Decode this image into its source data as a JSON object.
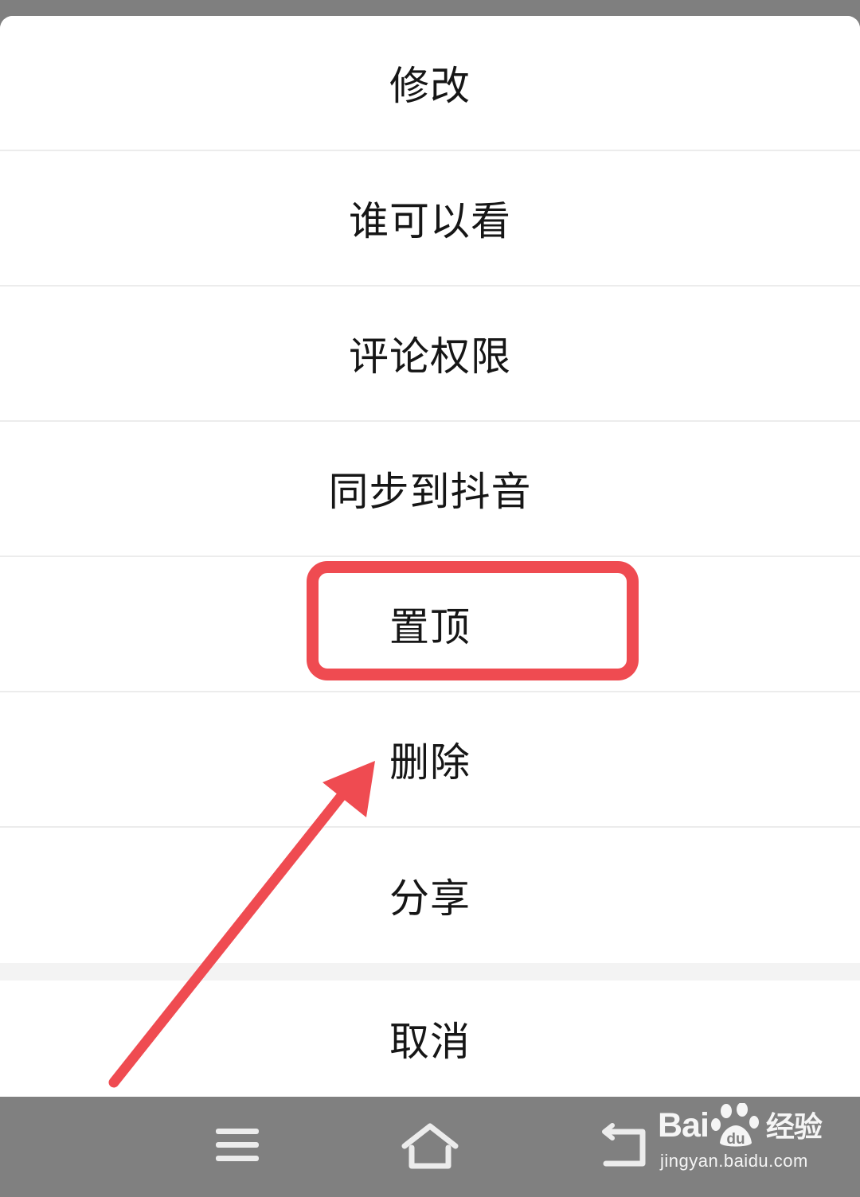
{
  "action_sheet": {
    "items": [
      {
        "label": "修改"
      },
      {
        "label": "谁可以看"
      },
      {
        "label": "评论权限"
      },
      {
        "label": "同步到抖音"
      },
      {
        "label": "置顶"
      },
      {
        "label": "删除"
      },
      {
        "label": "分享"
      }
    ],
    "cancel_label": "取消"
  },
  "annotations": {
    "highlighted_item": "置顶",
    "arrow_target": "删除",
    "color": "#ef4b51"
  },
  "navigation_bar": {
    "buttons": [
      {
        "icon": "menu-icon"
      },
      {
        "icon": "home-icon"
      },
      {
        "icon": "back-icon"
      }
    ]
  },
  "watermark": {
    "brand": "Bai经验",
    "brand_logo_text": "du",
    "url": "jingyan.baidu.com"
  },
  "colors": {
    "overlay": "#7f7f7f",
    "sheet_background": "#ffffff",
    "divider": "#ececec",
    "text": "#161616"
  }
}
